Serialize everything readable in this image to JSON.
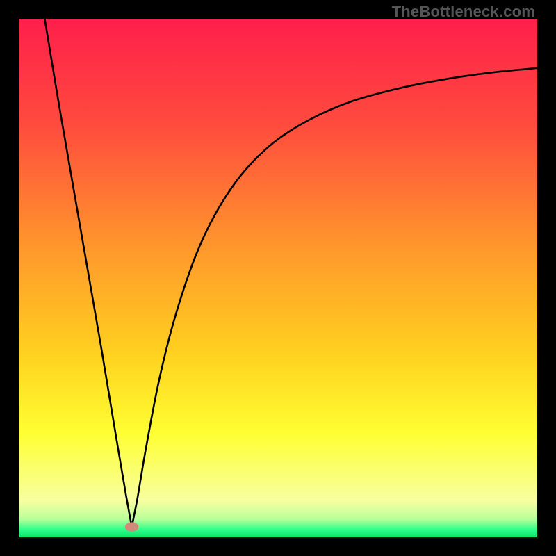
{
  "watermark": "TheBottleneck.com",
  "chart_data": {
    "type": "line",
    "title": "",
    "xlabel": "",
    "ylabel": "",
    "xlim": [
      0,
      100
    ],
    "ylim": [
      0,
      100
    ],
    "grid": false,
    "legend": false,
    "gradient_stops": [
      {
        "offset": 0.0,
        "color": "#ff1f4b"
      },
      {
        "offset": 0.2,
        "color": "#ff4a3e"
      },
      {
        "offset": 0.45,
        "color": "#ff9a2b"
      },
      {
        "offset": 0.65,
        "color": "#ffd21f"
      },
      {
        "offset": 0.8,
        "color": "#ffff33"
      },
      {
        "offset": 0.93,
        "color": "#f7ffa0"
      },
      {
        "offset": 0.965,
        "color": "#b9ff9a"
      },
      {
        "offset": 0.985,
        "color": "#2fff8a"
      },
      {
        "offset": 1.0,
        "color": "#07e56f"
      }
    ],
    "marker": {
      "x": 21.8,
      "y": 2.0,
      "color": "#d08a78",
      "rx": 1.3,
      "ry": 0.9
    },
    "series": [
      {
        "name": "curve",
        "x": [
          5.0,
          8.0,
          12.0,
          16.0,
          19.0,
          20.7,
          21.8,
          22.8,
          24.5,
          27.0,
          30.0,
          34.0,
          38.0,
          43.0,
          49.0,
          56.0,
          64.0,
          73.0,
          82.0,
          91.0,
          100.0
        ],
        "values": [
          100.0,
          82.0,
          59.0,
          36.0,
          18.0,
          8.0,
          2.0,
          7.0,
          17.0,
          30.0,
          42.0,
          54.0,
          62.5,
          70.0,
          76.0,
          80.5,
          84.0,
          86.5,
          88.3,
          89.6,
          90.5
        ]
      }
    ]
  }
}
